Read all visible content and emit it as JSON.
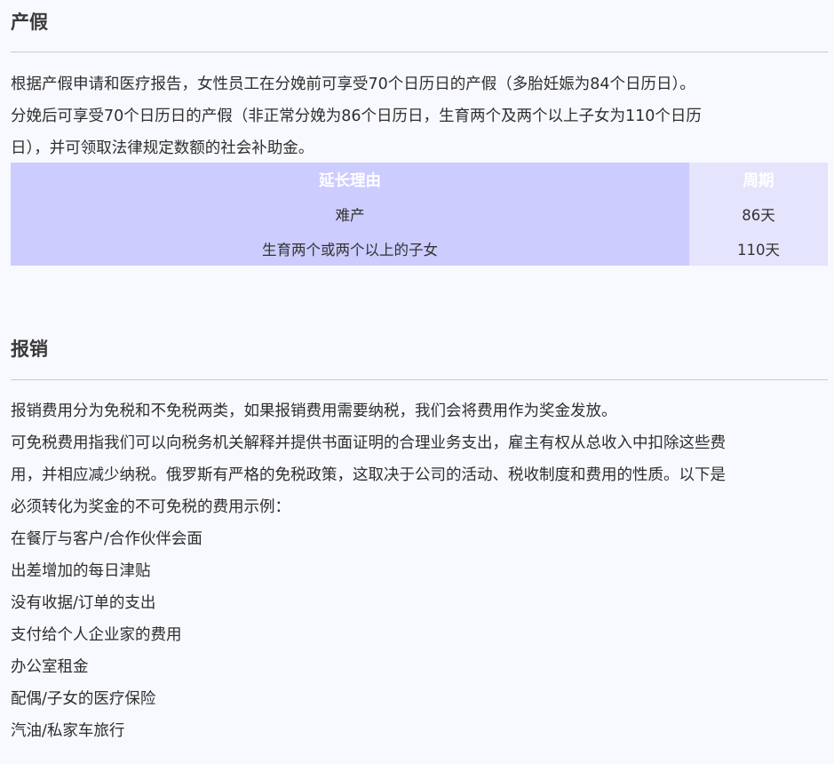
{
  "maternity": {
    "title": "产假",
    "paragraph_lines": [
      "根据产假申请和医疗报告，女性员工在分娩前可享受70个日历日的产假（多胎妊娠为84个日历日）。",
      "分娩后可享受70个日历日的产假（非正常分娩为86个日历日，生育两个及两个以上子女为110个日历",
      "日），并可领取法律规定数额的社会补助金。"
    ],
    "table": {
      "headers": [
        "延长理由",
        "周期"
      ],
      "rows": [
        [
          "难产",
          "86天"
        ],
        [
          "生育两个或两个以上的子女",
          "110天"
        ]
      ]
    }
  },
  "reimbursement": {
    "title": "报销",
    "paragraph_lines": [
      "报销费用分为免税和不免税两类，如果报销费用需要纳税，我们会将费用作为奖金发放。",
      "可免税费用指我们可以向税务机关解释并提供书面证明的合理业务支出，雇主有权从总收入中扣除这些费",
      "用，并相应减少纳税。俄罗斯有严格的免税政策，这取决于公司的活动、税收制度和费用的性质。以下是",
      "必须转化为奖金的不可免税的费用示例："
    ],
    "items": [
      "在餐厅与客户/合作伙伴会面",
      "出差增加的每日津贴",
      "没有收据/订单的支出",
      "支付给个人企业家的费用",
      "办公室租金",
      "配偶/子女的医疗保险",
      "汽油/私家车旅行"
    ]
  }
}
